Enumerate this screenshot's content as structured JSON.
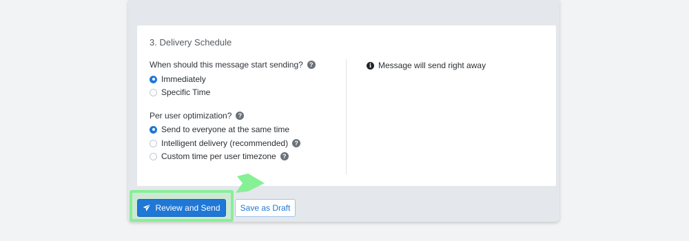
{
  "section": {
    "title": "3. Delivery Schedule"
  },
  "start": {
    "question": "When should this message start sending?",
    "options": [
      {
        "label": "Immediately",
        "checked": true
      },
      {
        "label": "Specific Time",
        "checked": false
      }
    ]
  },
  "optimization": {
    "question": "Per user optimization?",
    "options": [
      {
        "label": "Send to everyone at the same time",
        "checked": true
      },
      {
        "label": "Intelligent delivery (recommended)",
        "checked": false
      },
      {
        "label": "Custom time per user timezone",
        "checked": false
      }
    ]
  },
  "info": {
    "text": "Message will send right away",
    "icon": "info-icon"
  },
  "actions": {
    "review_send": "Review and Send",
    "save_draft": "Save as Draft"
  },
  "icons": {
    "help": "?",
    "info": "i",
    "send": "paper-plane-icon"
  },
  "colors": {
    "accent": "#1f77d6",
    "highlight": "#86f095"
  }
}
